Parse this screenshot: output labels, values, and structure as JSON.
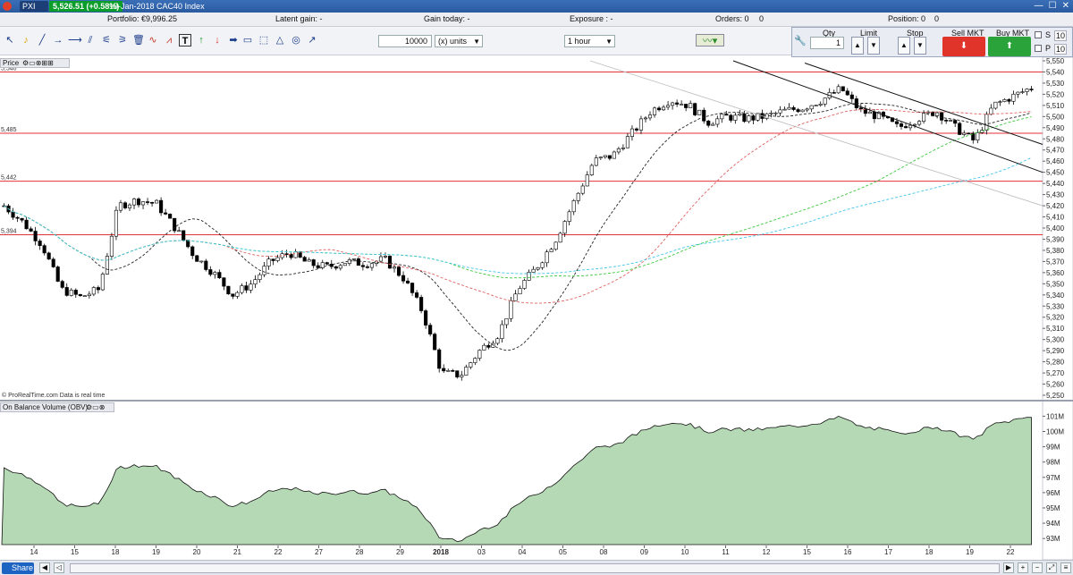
{
  "titlebar": {
    "symbol_label": "PXI",
    "price_change": "5,526.51 (+0.58%)",
    "title": "19-Jan-2018 CAC40 Index"
  },
  "summary": {
    "portfolio": "Portfolio: €9,996.25",
    "latent_gain": "Latent gain: -",
    "gain_today": "Gain today: -",
    "exposure": "Exposure : -",
    "orders": "Orders: 0",
    "orders_count": "0",
    "position": "Position: 0",
    "position_count": "0"
  },
  "toolbar": {
    "quantity": "10000",
    "units": "(x) units",
    "interval": "1 hour"
  },
  "order_panel": {
    "qty_label": "Qty",
    "qty_value": "1",
    "limit_label": "Limit",
    "stop_label": "Stop",
    "sell_label": "Sell MKT",
    "buy_label": "Buy MKT",
    "s_label": "S",
    "p_label": "P",
    "s_pct": "10",
    "p_pct": "10"
  },
  "price_panel": {
    "label": "Price",
    "credit": "© ProRealTime.com  Data is real time"
  },
  "obv_panel": {
    "label": "On Balance Volume (OBV)"
  },
  "bottombar": {
    "share_label": "Share"
  },
  "colors": {
    "up_candle": "#ffffff",
    "down_candle": "#000000",
    "horizontal_line": "#e2323a",
    "obv_fill": "#b5d9b5",
    "ma_fast": "#222222",
    "ma_mid": "#e06060",
    "ma_slow_green": "#3cc83c",
    "ma_slow_blue": "#44c6e8"
  },
  "chart_data": [
    {
      "type": "candlestick",
      "title": "CAC40 Index",
      "interval": "1 hour",
      "ylim": [
        5250,
        5550
      ],
      "y_ticks": [
        "5,550",
        "5,540",
        "5,530",
        "5,520",
        "5,510",
        "5,500",
        "5,490",
        "5,480",
        "5,470",
        "5,460",
        "5,450",
        "5,440",
        "5,430",
        "5,420",
        "5,410",
        "5,400",
        "5,390",
        "5,380",
        "5,370",
        "5,360",
        "5,350",
        "5,340",
        "5,330",
        "5,320",
        "5,310",
        "5,300",
        "5,290",
        "5,280",
        "5,270",
        "5,260",
        "5,250"
      ],
      "x_ticks": [
        "14",
        "15",
        "18",
        "19",
        "20",
        "21",
        "22",
        "27",
        "28",
        "29",
        "2018",
        "03",
        "04",
        "05",
        "08",
        "09",
        "10",
        "11",
        "12",
        "15",
        "16",
        "17",
        "18",
        "19",
        "22"
      ],
      "horizontal_lines": [
        {
          "label": "5,540",
          "value": 5540
        },
        {
          "label": "5,485",
          "value": 5485
        },
        {
          "label": "5,442",
          "value": 5442
        },
        {
          "label": "5,394",
          "value": 5394
        }
      ],
      "close_path": [
        5420,
        5405,
        5385,
        5345,
        5338,
        5345,
        5420,
        5425,
        5422,
        5400,
        5375,
        5360,
        5340,
        5350,
        5370,
        5378,
        5368,
        5365,
        5370,
        5368,
        5372,
        5355,
        5325,
        5270,
        5268,
        5290,
        5305,
        5345,
        5365,
        5390,
        5425,
        5460,
        5465,
        5485,
        5505,
        5515,
        5510,
        5495,
        5500,
        5498,
        5500,
        5505,
        5508,
        5515,
        5525,
        5505,
        5500,
        5490,
        5498,
        5505,
        5490,
        5478,
        5510,
        5518,
        5526
      ]
    },
    {
      "type": "area",
      "title": "On Balance Volume (OBV)",
      "y_ticks": [
        "101M",
        "100M",
        "99M",
        "98M",
        "97M",
        "96M",
        "95M",
        "94M",
        "93M"
      ],
      "ylim": [
        92.6,
        101.2
      ]
    }
  ]
}
